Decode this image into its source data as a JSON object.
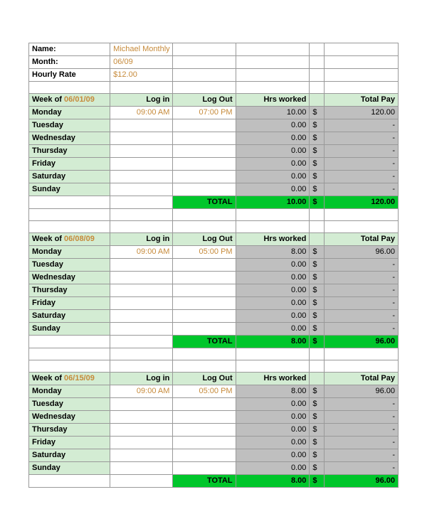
{
  "header": {
    "name_label": "Name:",
    "name_value": "Michael Monthly",
    "month_label": "Month:",
    "month_value": "06/09",
    "rate_label": "Hourly Rate",
    "rate_value": "$12.00"
  },
  "columns": {
    "weekof_label": "Week of ",
    "login": "Log in",
    "logout": "Log Out",
    "hrs": "Hrs worked",
    "pay": "Total Pay",
    "total": "TOTAL",
    "dollar": "$",
    "dash": "-"
  },
  "weeks": [
    {
      "date": "06/01/09",
      "days": [
        {
          "name": "Monday",
          "login": "09:00 AM",
          "logout": "07:00 PM",
          "hrs": "10.00",
          "pay": "120.00"
        },
        {
          "name": "Tuesday",
          "login": "",
          "logout": "",
          "hrs": "0.00",
          "pay": "-"
        },
        {
          "name": "Wednesday",
          "login": "",
          "logout": "",
          "hrs": "0.00",
          "pay": "-"
        },
        {
          "name": "Thursday",
          "login": "",
          "logout": "",
          "hrs": "0.00",
          "pay": "-"
        },
        {
          "name": "Friday",
          "login": "",
          "logout": "",
          "hrs": "0.00",
          "pay": "-"
        },
        {
          "name": "Saturday",
          "login": "",
          "logout": "",
          "hrs": "0.00",
          "pay": "-"
        },
        {
          "name": "Sunday",
          "login": "",
          "logout": "",
          "hrs": "0.00",
          "pay": "-"
        }
      ],
      "total_hrs": "10.00",
      "total_pay": "120.00"
    },
    {
      "date": "06/08/09",
      "days": [
        {
          "name": "Monday",
          "login": "09:00 AM",
          "logout": "05:00 PM",
          "hrs": "8.00",
          "pay": "96.00"
        },
        {
          "name": "Tuesday",
          "login": "",
          "logout": "",
          "hrs": "0.00",
          "pay": "-"
        },
        {
          "name": "Wednesday",
          "login": "",
          "logout": "",
          "hrs": "0.00",
          "pay": "-"
        },
        {
          "name": "Thursday",
          "login": "",
          "logout": "",
          "hrs": "0.00",
          "pay": "-"
        },
        {
          "name": "Friday",
          "login": "",
          "logout": "",
          "hrs": "0.00",
          "pay": "-"
        },
        {
          "name": "Saturday",
          "login": "",
          "logout": "",
          "hrs": "0.00",
          "pay": "-"
        },
        {
          "name": "Sunday",
          "login": "",
          "logout": "",
          "hrs": "0.00",
          "pay": "-"
        }
      ],
      "total_hrs": "8.00",
      "total_pay": "96.00"
    },
    {
      "date": "06/15/09",
      "days": [
        {
          "name": "Monday",
          "login": "09:00 AM",
          "logout": "05:00 PM",
          "hrs": "8.00",
          "pay": "96.00"
        },
        {
          "name": "Tuesday",
          "login": "",
          "logout": "",
          "hrs": "0.00",
          "pay": "-"
        },
        {
          "name": "Wednesday",
          "login": "",
          "logout": "",
          "hrs": "0.00",
          "pay": "-"
        },
        {
          "name": "Thursday",
          "login": "",
          "logout": "",
          "hrs": "0.00",
          "pay": "-"
        },
        {
          "name": "Friday",
          "login": "",
          "logout": "",
          "hrs": "0.00",
          "pay": "-"
        },
        {
          "name": "Saturday",
          "login": "",
          "logout": "",
          "hrs": "0.00",
          "pay": "-"
        },
        {
          "name": "Sunday",
          "login": "",
          "logout": "",
          "hrs": "0.00",
          "pay": "-"
        }
      ],
      "total_hrs": "8.00",
      "total_pay": "96.00"
    }
  ]
}
